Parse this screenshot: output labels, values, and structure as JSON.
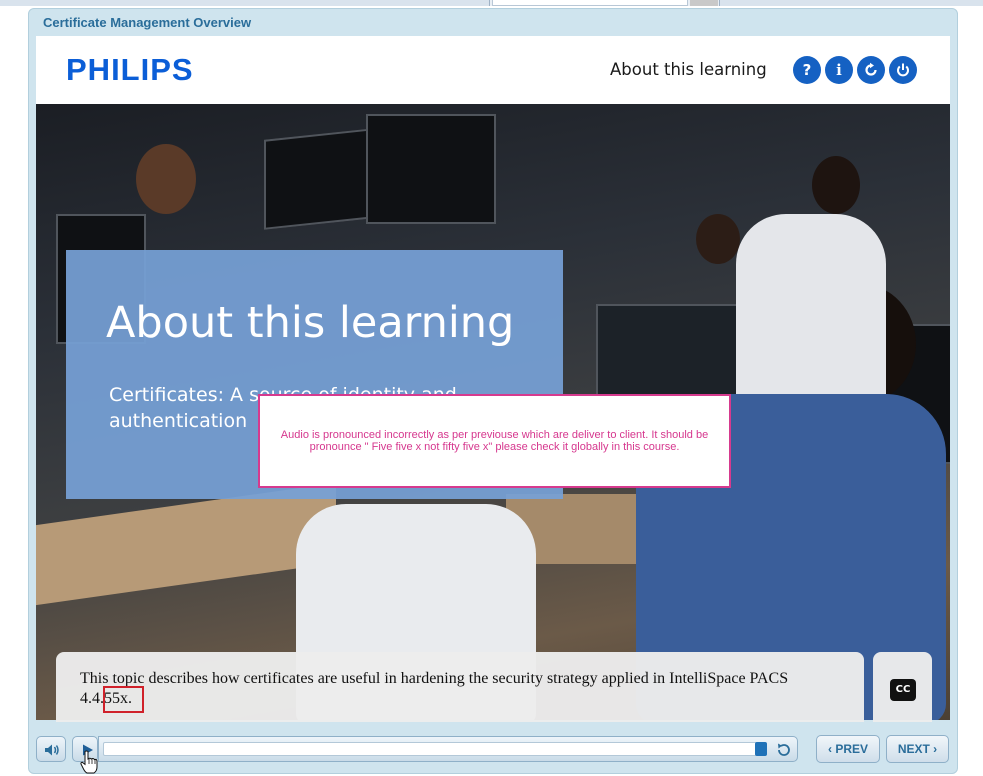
{
  "window": {
    "title": "Certificate Management Overview"
  },
  "header": {
    "logo": "PHILIPS",
    "title": "About this learning",
    "buttons": [
      {
        "name": "help",
        "label": "?",
        "icon": "help-icon"
      },
      {
        "name": "info",
        "label": "i",
        "icon": "info-icon"
      },
      {
        "name": "restart",
        "label": "",
        "icon": "refresh-icon"
      },
      {
        "name": "exit",
        "label": "",
        "icon": "power-icon"
      }
    ]
  },
  "slide": {
    "heading": "About this learning",
    "subheading": "Certificates: A source of identity and authentication"
  },
  "review_note": {
    "text": "Audio is pronounced incorrectly as per previouse which are deliver to client. It should be pronounce \" Five five x not fifty five x\" please check it globally in this course."
  },
  "caption": {
    "text": "This topic describes how certificates are useful in hardening the security strategy applied in IntelliSpace PACS 4.4.55x.",
    "cc_label": "CC"
  },
  "controls": {
    "volume_icon": "speaker-icon",
    "play_icon": "play-icon",
    "progress": 0.0,
    "replay_icon": "replay-icon",
    "prev_label": "‹ PREV",
    "next_label": "NEXT ›"
  },
  "colors": {
    "accent": "#1561c3",
    "brand": "#0b5ed7",
    "note": "#d6378e",
    "highlight": "#d0212a"
  }
}
